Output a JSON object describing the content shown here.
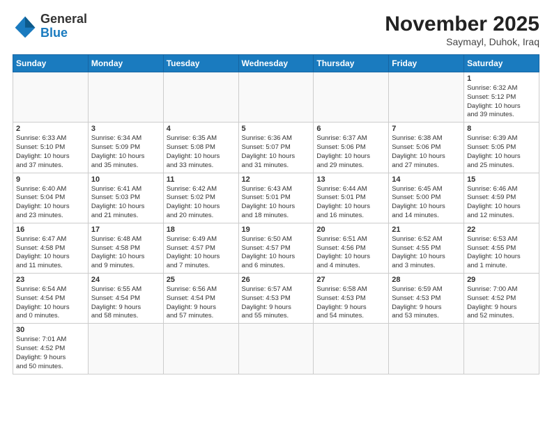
{
  "header": {
    "logo_general": "General",
    "logo_blue": "Blue",
    "month_title": "November 2025",
    "location": "Saymayl, Duhok, Iraq"
  },
  "weekdays": [
    "Sunday",
    "Monday",
    "Tuesday",
    "Wednesday",
    "Thursday",
    "Friday",
    "Saturday"
  ],
  "days": [
    {
      "num": "",
      "info": ""
    },
    {
      "num": "",
      "info": ""
    },
    {
      "num": "",
      "info": ""
    },
    {
      "num": "",
      "info": ""
    },
    {
      "num": "",
      "info": ""
    },
    {
      "num": "",
      "info": ""
    },
    {
      "num": "1",
      "info": "Sunrise: 6:32 AM\nSunset: 5:12 PM\nDaylight: 10 hours\nand 39 minutes."
    },
    {
      "num": "2",
      "info": "Sunrise: 6:33 AM\nSunset: 5:10 PM\nDaylight: 10 hours\nand 37 minutes."
    },
    {
      "num": "3",
      "info": "Sunrise: 6:34 AM\nSunset: 5:09 PM\nDaylight: 10 hours\nand 35 minutes."
    },
    {
      "num": "4",
      "info": "Sunrise: 6:35 AM\nSunset: 5:08 PM\nDaylight: 10 hours\nand 33 minutes."
    },
    {
      "num": "5",
      "info": "Sunrise: 6:36 AM\nSunset: 5:07 PM\nDaylight: 10 hours\nand 31 minutes."
    },
    {
      "num": "6",
      "info": "Sunrise: 6:37 AM\nSunset: 5:06 PM\nDaylight: 10 hours\nand 29 minutes."
    },
    {
      "num": "7",
      "info": "Sunrise: 6:38 AM\nSunset: 5:06 PM\nDaylight: 10 hours\nand 27 minutes."
    },
    {
      "num": "8",
      "info": "Sunrise: 6:39 AM\nSunset: 5:05 PM\nDaylight: 10 hours\nand 25 minutes."
    },
    {
      "num": "9",
      "info": "Sunrise: 6:40 AM\nSunset: 5:04 PM\nDaylight: 10 hours\nand 23 minutes."
    },
    {
      "num": "10",
      "info": "Sunrise: 6:41 AM\nSunset: 5:03 PM\nDaylight: 10 hours\nand 21 minutes."
    },
    {
      "num": "11",
      "info": "Sunrise: 6:42 AM\nSunset: 5:02 PM\nDaylight: 10 hours\nand 20 minutes."
    },
    {
      "num": "12",
      "info": "Sunrise: 6:43 AM\nSunset: 5:01 PM\nDaylight: 10 hours\nand 18 minutes."
    },
    {
      "num": "13",
      "info": "Sunrise: 6:44 AM\nSunset: 5:01 PM\nDaylight: 10 hours\nand 16 minutes."
    },
    {
      "num": "14",
      "info": "Sunrise: 6:45 AM\nSunset: 5:00 PM\nDaylight: 10 hours\nand 14 minutes."
    },
    {
      "num": "15",
      "info": "Sunrise: 6:46 AM\nSunset: 4:59 PM\nDaylight: 10 hours\nand 12 minutes."
    },
    {
      "num": "16",
      "info": "Sunrise: 6:47 AM\nSunset: 4:58 PM\nDaylight: 10 hours\nand 11 minutes."
    },
    {
      "num": "17",
      "info": "Sunrise: 6:48 AM\nSunset: 4:58 PM\nDaylight: 10 hours\nand 9 minutes."
    },
    {
      "num": "18",
      "info": "Sunrise: 6:49 AM\nSunset: 4:57 PM\nDaylight: 10 hours\nand 7 minutes."
    },
    {
      "num": "19",
      "info": "Sunrise: 6:50 AM\nSunset: 4:57 PM\nDaylight: 10 hours\nand 6 minutes."
    },
    {
      "num": "20",
      "info": "Sunrise: 6:51 AM\nSunset: 4:56 PM\nDaylight: 10 hours\nand 4 minutes."
    },
    {
      "num": "21",
      "info": "Sunrise: 6:52 AM\nSunset: 4:55 PM\nDaylight: 10 hours\nand 3 minutes."
    },
    {
      "num": "22",
      "info": "Sunrise: 6:53 AM\nSunset: 4:55 PM\nDaylight: 10 hours\nand 1 minute."
    },
    {
      "num": "23",
      "info": "Sunrise: 6:54 AM\nSunset: 4:54 PM\nDaylight: 10 hours\nand 0 minutes."
    },
    {
      "num": "24",
      "info": "Sunrise: 6:55 AM\nSunset: 4:54 PM\nDaylight: 9 hours\nand 58 minutes."
    },
    {
      "num": "25",
      "info": "Sunrise: 6:56 AM\nSunset: 4:54 PM\nDaylight: 9 hours\nand 57 minutes."
    },
    {
      "num": "26",
      "info": "Sunrise: 6:57 AM\nSunset: 4:53 PM\nDaylight: 9 hours\nand 55 minutes."
    },
    {
      "num": "27",
      "info": "Sunrise: 6:58 AM\nSunset: 4:53 PM\nDaylight: 9 hours\nand 54 minutes."
    },
    {
      "num": "28",
      "info": "Sunrise: 6:59 AM\nSunset: 4:53 PM\nDaylight: 9 hours\nand 53 minutes."
    },
    {
      "num": "29",
      "info": "Sunrise: 7:00 AM\nSunset: 4:52 PM\nDaylight: 9 hours\nand 52 minutes."
    },
    {
      "num": "30",
      "info": "Sunrise: 7:01 AM\nSunset: 4:52 PM\nDaylight: 9 hours\nand 50 minutes."
    }
  ]
}
